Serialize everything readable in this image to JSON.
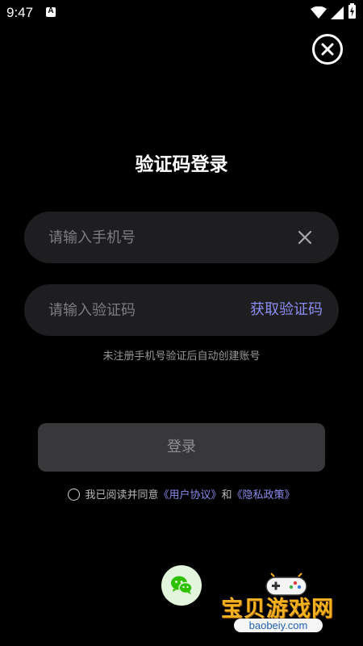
{
  "status_bar": {
    "time": "9:47",
    "notification_icon_letter": "A",
    "icons": [
      "a-notification-icon",
      "wifi-icon",
      "signal-icon",
      "battery-icon"
    ]
  },
  "close_icon": "close-circle-icon",
  "title": "验证码登录",
  "phone_field": {
    "placeholder": "请输入手机号",
    "value": "",
    "clear_icon": "close-icon"
  },
  "code_field": {
    "placeholder": "请输入验证码",
    "value": "",
    "get_code_label": "获取验证码"
  },
  "hint": "未注册手机号验证后自动创建账号",
  "login_label": "登录",
  "agreement": {
    "prefix": "我已阅读并同意",
    "user_agreement": "《用户协议》",
    "conjunction": "和",
    "privacy_policy": "《隐私政策》",
    "checked": false
  },
  "wechat_icon": "wechat-icon",
  "watermark": {
    "title": "宝贝游戏网",
    "url": "baobeiy.com"
  },
  "colors": {
    "background": "#000000",
    "field_background": "#1e1e20",
    "accent": "#8b8cf0",
    "login_button": "#38383a",
    "wechat_background": "#e3f5dc",
    "wechat_green": "#2dc100"
  }
}
